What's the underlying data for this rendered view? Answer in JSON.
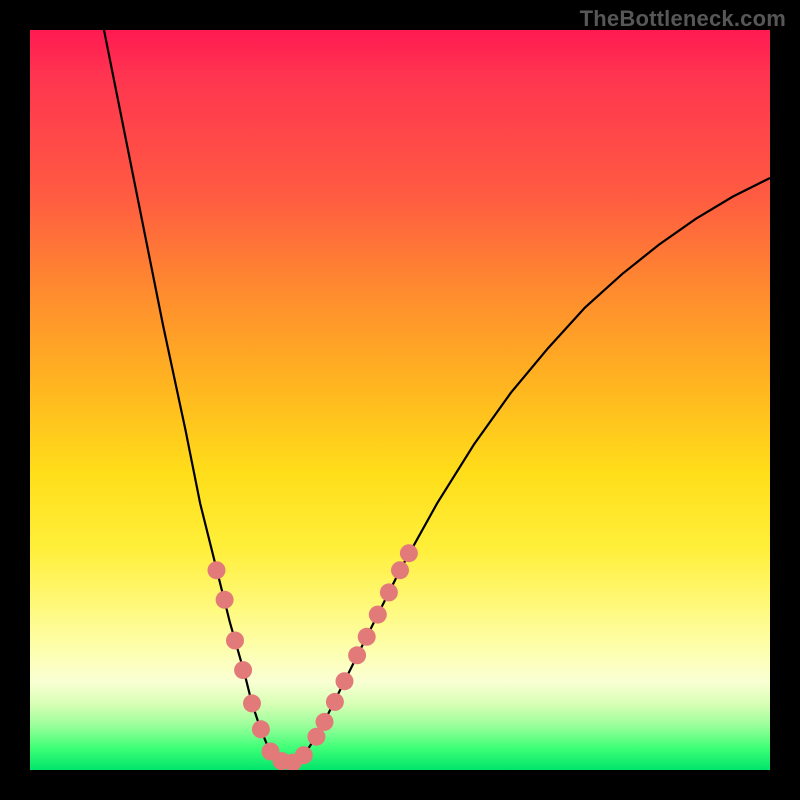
{
  "watermark": "TheBottleneck.com",
  "chart_data": {
    "type": "line",
    "title": "",
    "xlabel": "",
    "ylabel": "",
    "xlim": [
      0,
      100
    ],
    "ylim": [
      0,
      100
    ],
    "grid": false,
    "legend": false,
    "curve": [
      {
        "x": 10,
        "y": 100
      },
      {
        "x": 12,
        "y": 90
      },
      {
        "x": 15,
        "y": 75
      },
      {
        "x": 18,
        "y": 60
      },
      {
        "x": 21,
        "y": 46
      },
      {
        "x": 23,
        "y": 36
      },
      {
        "x": 25,
        "y": 28
      },
      {
        "x": 27,
        "y": 20
      },
      {
        "x": 29,
        "y": 13
      },
      {
        "x": 30,
        "y": 9
      },
      {
        "x": 31,
        "y": 6
      },
      {
        "x": 32,
        "y": 3.5
      },
      {
        "x": 33,
        "y": 2
      },
      {
        "x": 34,
        "y": 1
      },
      {
        "x": 35,
        "y": 0.5
      },
      {
        "x": 36,
        "y": 1
      },
      {
        "x": 37,
        "y": 2
      },
      {
        "x": 38,
        "y": 3.5
      },
      {
        "x": 40,
        "y": 7
      },
      {
        "x": 42,
        "y": 11
      },
      {
        "x": 44,
        "y": 15
      },
      {
        "x": 46,
        "y": 19
      },
      {
        "x": 50,
        "y": 27
      },
      {
        "x": 55,
        "y": 36
      },
      {
        "x": 60,
        "y": 44
      },
      {
        "x": 65,
        "y": 51
      },
      {
        "x": 70,
        "y": 57
      },
      {
        "x": 75,
        "y": 62.5
      },
      {
        "x": 80,
        "y": 67
      },
      {
        "x": 85,
        "y": 71
      },
      {
        "x": 90,
        "y": 74.5
      },
      {
        "x": 95,
        "y": 77.5
      },
      {
        "x": 100,
        "y": 80
      }
    ],
    "markers_left": [
      {
        "x": 25.2,
        "y": 27
      },
      {
        "x": 26.3,
        "y": 23
      },
      {
        "x": 27.7,
        "y": 17.5
      },
      {
        "x": 28.8,
        "y": 13.5
      },
      {
        "x": 30.0,
        "y": 9.0
      },
      {
        "x": 31.2,
        "y": 5.5
      }
    ],
    "markers_right": [
      {
        "x": 38.7,
        "y": 4.5
      },
      {
        "x": 39.8,
        "y": 6.5
      },
      {
        "x": 41.2,
        "y": 9.2
      },
      {
        "x": 42.5,
        "y": 12.0
      },
      {
        "x": 44.2,
        "y": 15.5
      },
      {
        "x": 45.5,
        "y": 18.0
      },
      {
        "x": 47.0,
        "y": 21.0
      },
      {
        "x": 48.5,
        "y": 24.0
      },
      {
        "x": 50.0,
        "y": 27.0
      },
      {
        "x": 51.2,
        "y": 29.3
      }
    ],
    "markers_bottom": [
      {
        "x": 32.5,
        "y": 2.5
      },
      {
        "x": 34.0,
        "y": 1.2
      },
      {
        "x": 35.5,
        "y": 1.0
      },
      {
        "x": 37.0,
        "y": 2.0
      }
    ],
    "marker_color": "#e27a7a",
    "curve_color": "#000000",
    "gradient": [
      "#ff1a51",
      "#ff8a2f",
      "#ffde1a",
      "#fdffb0",
      "#00e56b"
    ]
  }
}
